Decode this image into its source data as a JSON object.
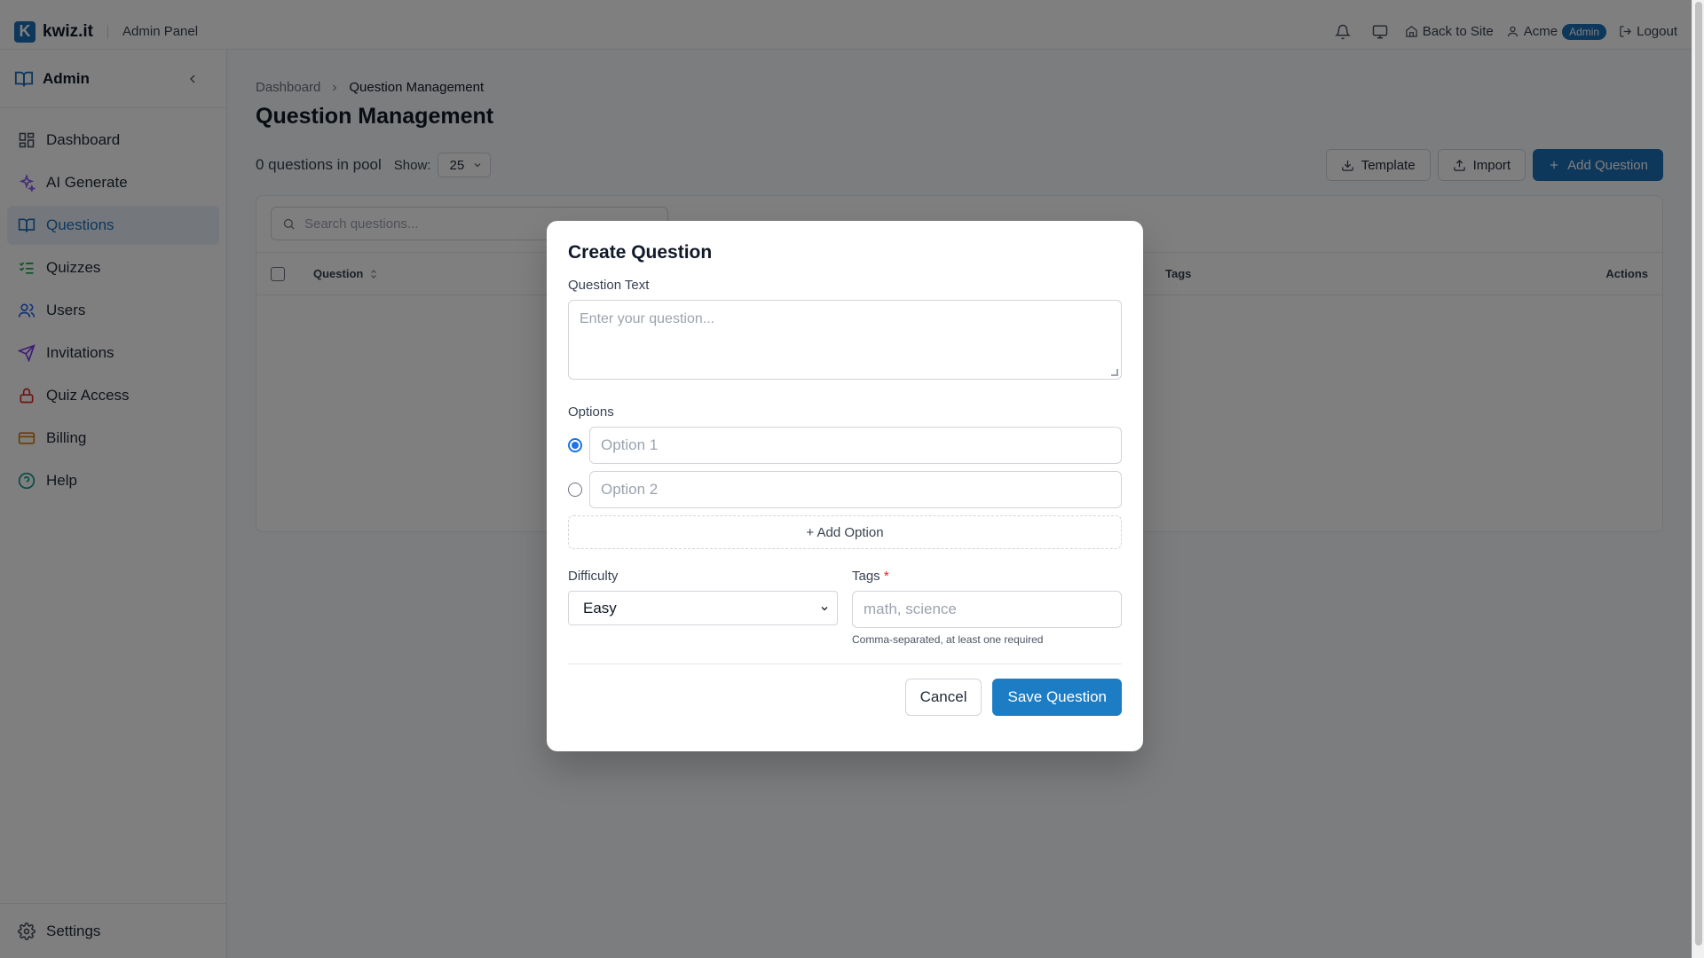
{
  "header": {
    "logo_letter": "K",
    "brand": "kwiz.it",
    "panel_label": "Admin Panel",
    "back_to_site": "Back to Site",
    "user_name": "Acme",
    "role_badge": "Admin",
    "logout": "Logout"
  },
  "sidebar": {
    "title": "Admin",
    "items": [
      {
        "label": "Dashboard",
        "icon": "dashboard-icon"
      },
      {
        "label": "AI Generate",
        "icon": "sparkles-icon"
      },
      {
        "label": "Questions",
        "icon": "book-icon",
        "active": true
      },
      {
        "label": "Quizzes",
        "icon": "list-checks-icon"
      },
      {
        "label": "Users",
        "icon": "users-icon"
      },
      {
        "label": "Invitations",
        "icon": "send-icon"
      },
      {
        "label": "Quiz Access",
        "icon": "lock-icon"
      },
      {
        "label": "Billing",
        "icon": "credit-card-icon"
      },
      {
        "label": "Help",
        "icon": "help-circle-icon"
      }
    ],
    "footer": {
      "label": "Settings",
      "icon": "gear-icon"
    }
  },
  "main": {
    "breadcrumb": {
      "root": "Dashboard",
      "current": "Question Management"
    },
    "title": "Question Management",
    "pool_count": "0 questions in pool",
    "show_label": "Show:",
    "page_size": "25",
    "buttons": {
      "template": "Template",
      "import": "Import",
      "add_question": "Add Question"
    },
    "search_placeholder": "Search questions...",
    "columns": {
      "question": "Question",
      "tags": "Tags",
      "actions": "Actions"
    }
  },
  "modal": {
    "title": "Create Question",
    "question_text_label": "Question Text",
    "question_text_placeholder": "Enter your question...",
    "options_label": "Options",
    "options": [
      {
        "placeholder": "Option 1",
        "selected": true
      },
      {
        "placeholder": "Option 2",
        "selected": false
      }
    ],
    "add_option": "+ Add Option",
    "difficulty_label": "Difficulty",
    "difficulty_value": "Easy",
    "tags_label": "Tags",
    "tags_required_mark": "*",
    "tags_placeholder": "math, science",
    "tags_help": "Comma-separated, at least one required",
    "cancel": "Cancel",
    "save": "Save Question"
  },
  "colors": {
    "accent": "#1d6fb8",
    "save_button": "#1d7dc4",
    "radio_checked": "#1a73e8",
    "required": "#dc2626",
    "overlay": "rgba(0,0,0,0.5)"
  }
}
